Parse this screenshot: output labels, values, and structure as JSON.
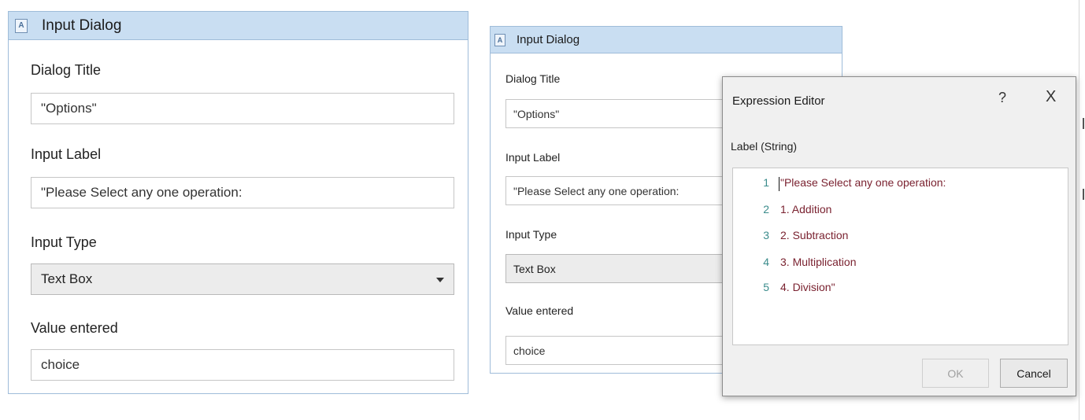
{
  "panel_left": {
    "header_title": "Input Dialog",
    "icon": "text-activity-icon",
    "fields": {
      "dialog_title": {
        "label": "Dialog Title",
        "value": "\"Options\""
      },
      "input_label": {
        "label": "Input Label",
        "value": "\"Please Select any one operation:"
      },
      "input_type": {
        "label": "Input Type",
        "value": "Text Box"
      },
      "value_entered": {
        "label": "Value entered",
        "value": "choice"
      }
    }
  },
  "panel_right": {
    "header_title": "Input Dialog",
    "icon": "text-activity-icon",
    "fields": {
      "dialog_title": {
        "label": "Dialog Title",
        "value": "\"Options\""
      },
      "input_label": {
        "label": "Input Label",
        "value": "\"Please Select any one operation:"
      },
      "input_type": {
        "label": "Input Type",
        "value": "Text Box"
      },
      "value_entered": {
        "label": "Value entered",
        "value": "choice"
      }
    }
  },
  "expression_editor": {
    "title": "Expression Editor",
    "help_label": "?",
    "close_label": "X",
    "sublabel": "Label (String)",
    "lines": [
      {
        "number": "1",
        "text": "\"Please Select any one operation:"
      },
      {
        "number": "2",
        "text": "1. Addition"
      },
      {
        "number": "3",
        "text": "2. Subtraction"
      },
      {
        "number": "4",
        "text": "3. Multiplication"
      },
      {
        "number": "5",
        "text": "4. Division\""
      }
    ],
    "ok_label": "OK",
    "cancel_label": "Cancel"
  }
}
